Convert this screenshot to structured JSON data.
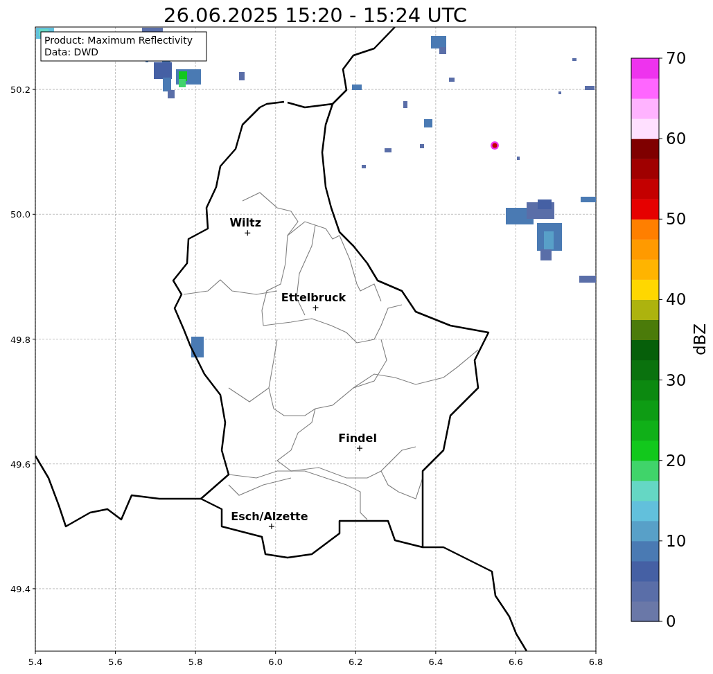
{
  "title": "26.06.2025 15:20 - 15:24 UTC",
  "map": {
    "info_box": [
      "Product: Maximum Reflectivity",
      "Data: DWD"
    ],
    "cities": [
      "Wiltz",
      "Ettelbruck",
      "Findel",
      "Esch/Alzette"
    ],
    "chart_data": {
      "type": "scatter",
      "grid": true,
      "xlim": [
        5.4,
        6.8
      ],
      "ylim": [
        49.3,
        50.3
      ],
      "xticks": [
        {
          "value": 5.4,
          "label": "5.4"
        },
        {
          "value": 5.6,
          "label": "5.6"
        },
        {
          "value": 5.8,
          "label": "5.8"
        },
        {
          "value": 6.0,
          "label": "6.0"
        },
        {
          "value": 6.2,
          "label": "6.2"
        },
        {
          "value": 6.4,
          "label": "6.4"
        },
        {
          "value": 6.6,
          "label": "6.6"
        },
        {
          "value": 6.8,
          "label": "6.8"
        }
      ],
      "yticks": [
        {
          "value": 49.4,
          "label": "49.4"
        },
        {
          "value": 49.6,
          "label": "49.6"
        },
        {
          "value": 49.8,
          "label": "49.8"
        },
        {
          "value": 50.0,
          "label": "50.0"
        },
        {
          "value": 50.2,
          "label": "50.2"
        }
      ],
      "x": [
        5.93,
        6.1,
        6.21,
        5.99
      ],
      "series": [
        {
          "color": "#000000",
          "values": [
            49.97,
            49.85,
            49.625,
            49.5
          ]
        }
      ]
    }
  },
  "colorbar": {
    "label": "dBZ",
    "ticks": [
      "70",
      "60",
      "50",
      "40",
      "30",
      "20",
      "10",
      "0"
    ],
    "segments": [
      {
        "color": "#6a78a8"
      },
      {
        "color": "#5a6ea8"
      },
      {
        "color": "#4560a4"
      },
      {
        "color": "#4a7ab3"
      },
      {
        "color": "#58a0c8"
      },
      {
        "color": "#62c0dc"
      },
      {
        "color": "#65d7c4"
      },
      {
        "color": "#40d46a"
      },
      {
        "color": "#12c81c"
      },
      {
        "color": "#10b018"
      },
      {
        "color": "#0e9c14"
      },
      {
        "color": "#0c8910"
      },
      {
        "color": "#0a720e"
      },
      {
        "color": "#065f0a"
      },
      {
        "color": "#4b7b0a"
      },
      {
        "color": "#adb30e"
      },
      {
        "color": "#ffd700"
      },
      {
        "color": "#ffb400"
      },
      {
        "color": "#ff9a00"
      },
      {
        "color": "#ff7f00"
      },
      {
        "color": "#e60000"
      },
      {
        "color": "#c40000"
      },
      {
        "color": "#a00000"
      },
      {
        "color": "#7f0000"
      },
      {
        "color": "#ffe0ff"
      },
      {
        "color": "#ffb3ff"
      },
      {
        "color": "#ff66ff"
      },
      {
        "color": "#ee33ee"
      }
    ]
  }
}
